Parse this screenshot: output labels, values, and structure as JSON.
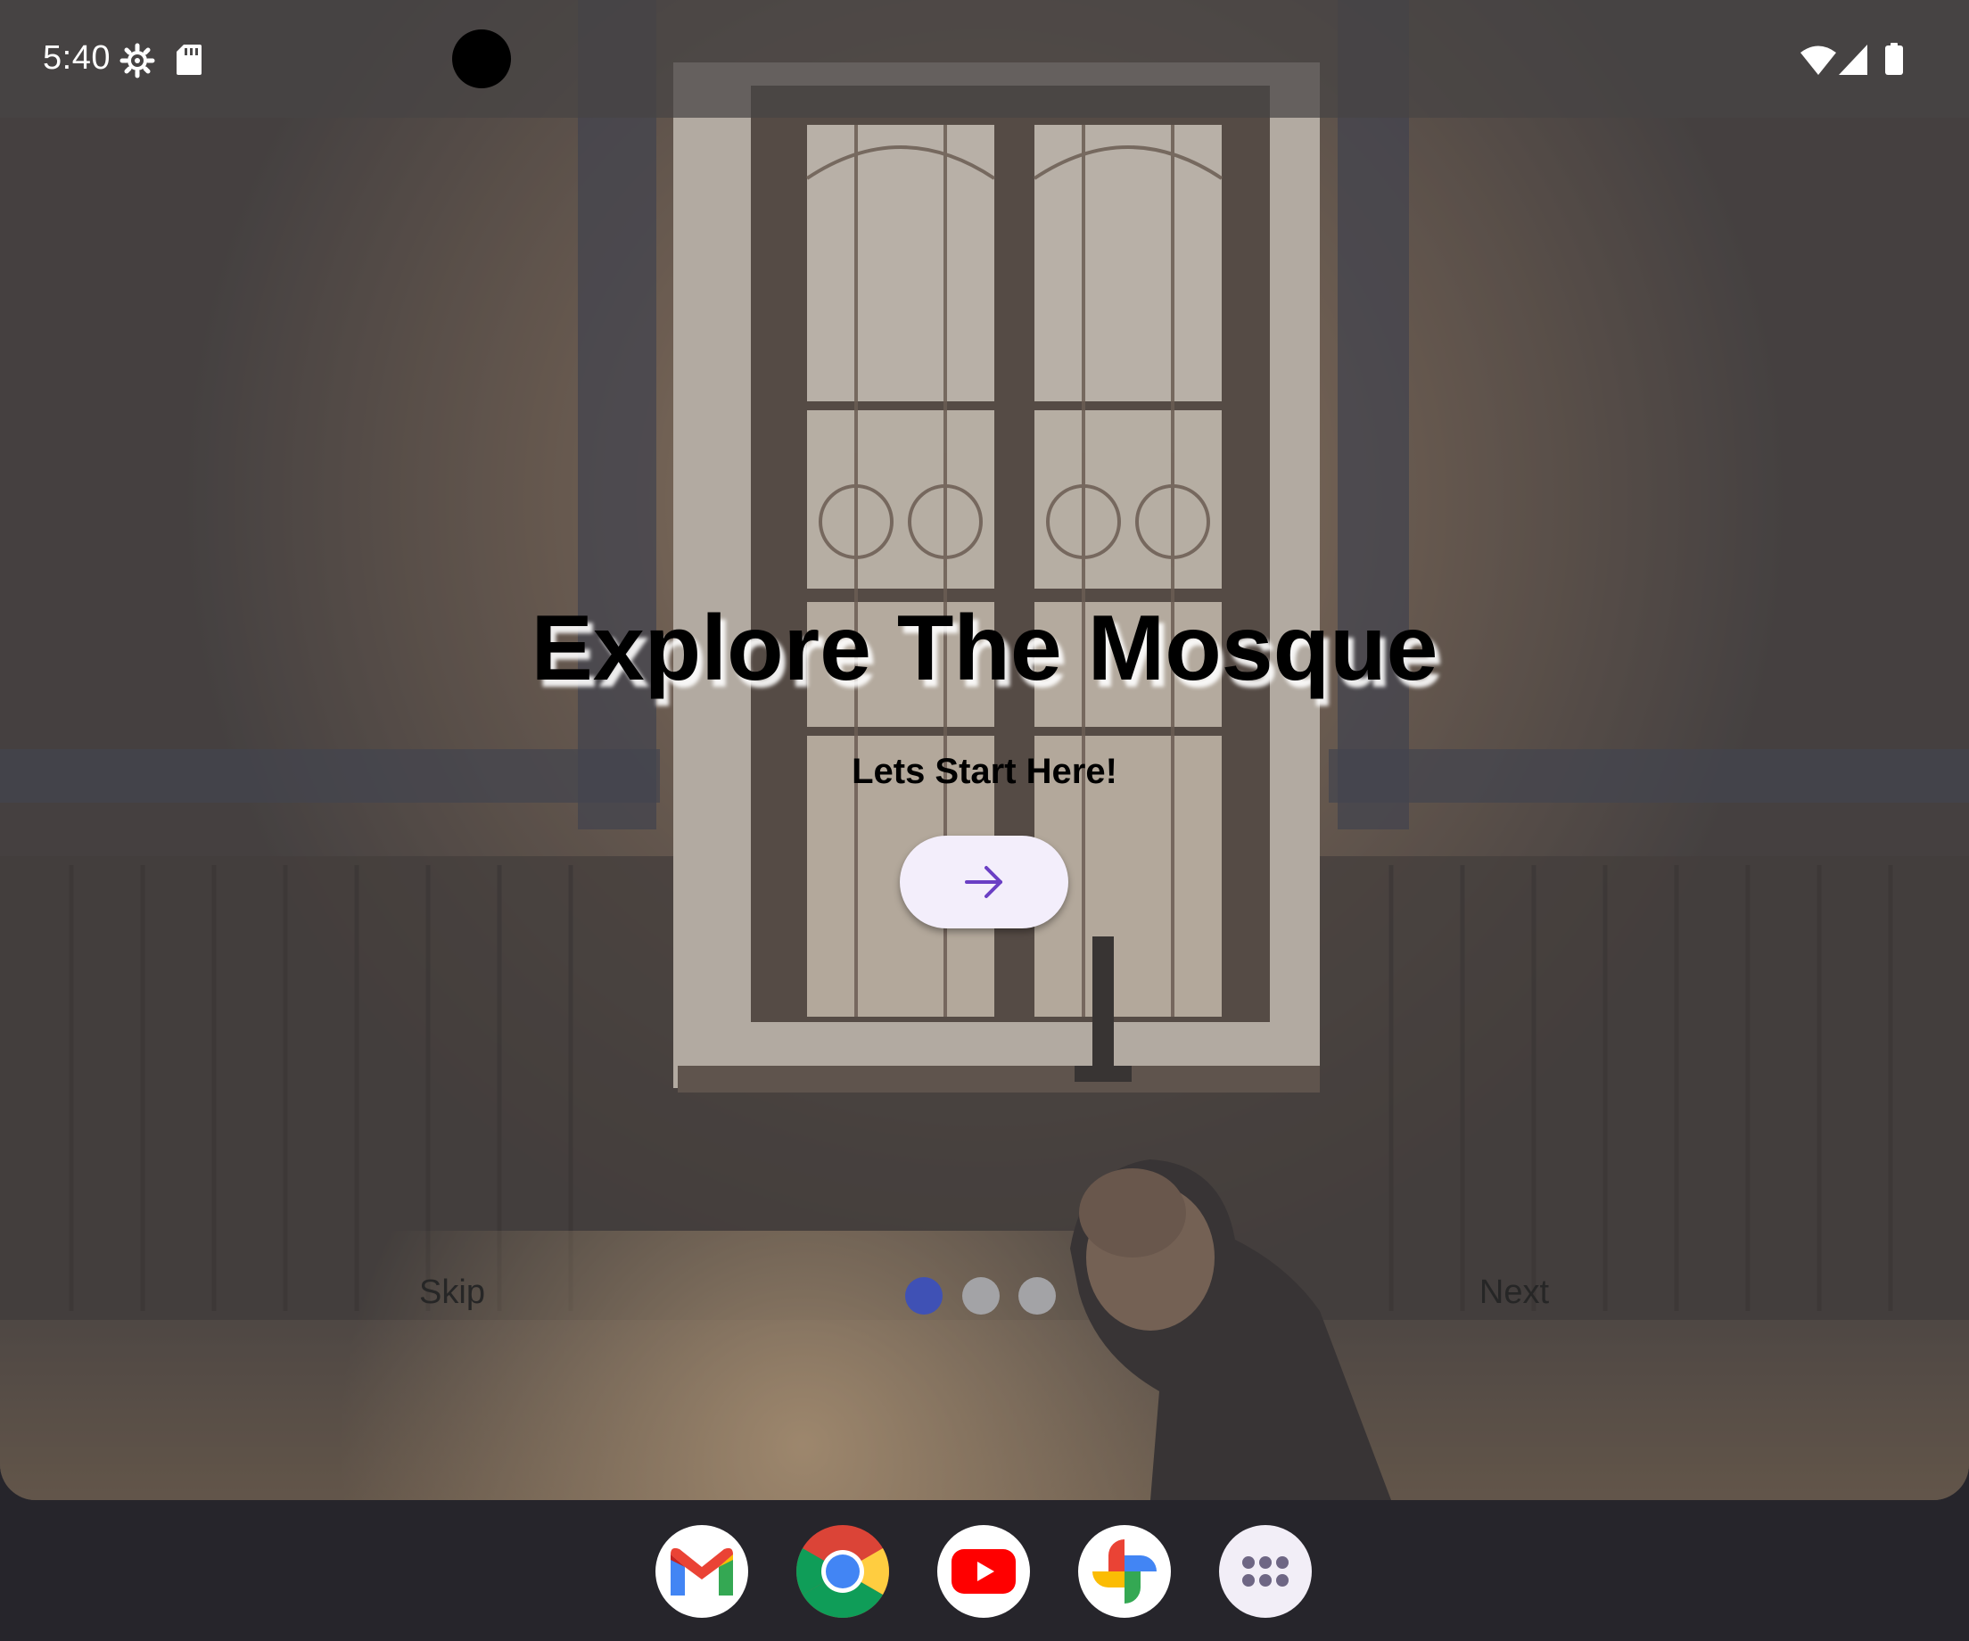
{
  "status_bar": {
    "time": "5:40"
  },
  "onboarding": {
    "title": "Explore The Mosque",
    "subtitle": "Lets Start Here!",
    "skip_label": "Skip",
    "next_label": "Next",
    "page_indicator": {
      "total": 3,
      "active_index": 0,
      "active_color": "#3f51b5",
      "inactive_color": "#a3a3a6"
    },
    "accent_color": "#6a3fc4"
  },
  "dock": {
    "apps": [
      {
        "name": "Gmail",
        "icon": "gmail-icon"
      },
      {
        "name": "Chrome",
        "icon": "chrome-icon"
      },
      {
        "name": "YouTube",
        "icon": "youtube-icon"
      },
      {
        "name": "Photos",
        "icon": "photos-icon"
      },
      {
        "name": "All apps",
        "icon": "app-drawer-icon"
      }
    ]
  }
}
